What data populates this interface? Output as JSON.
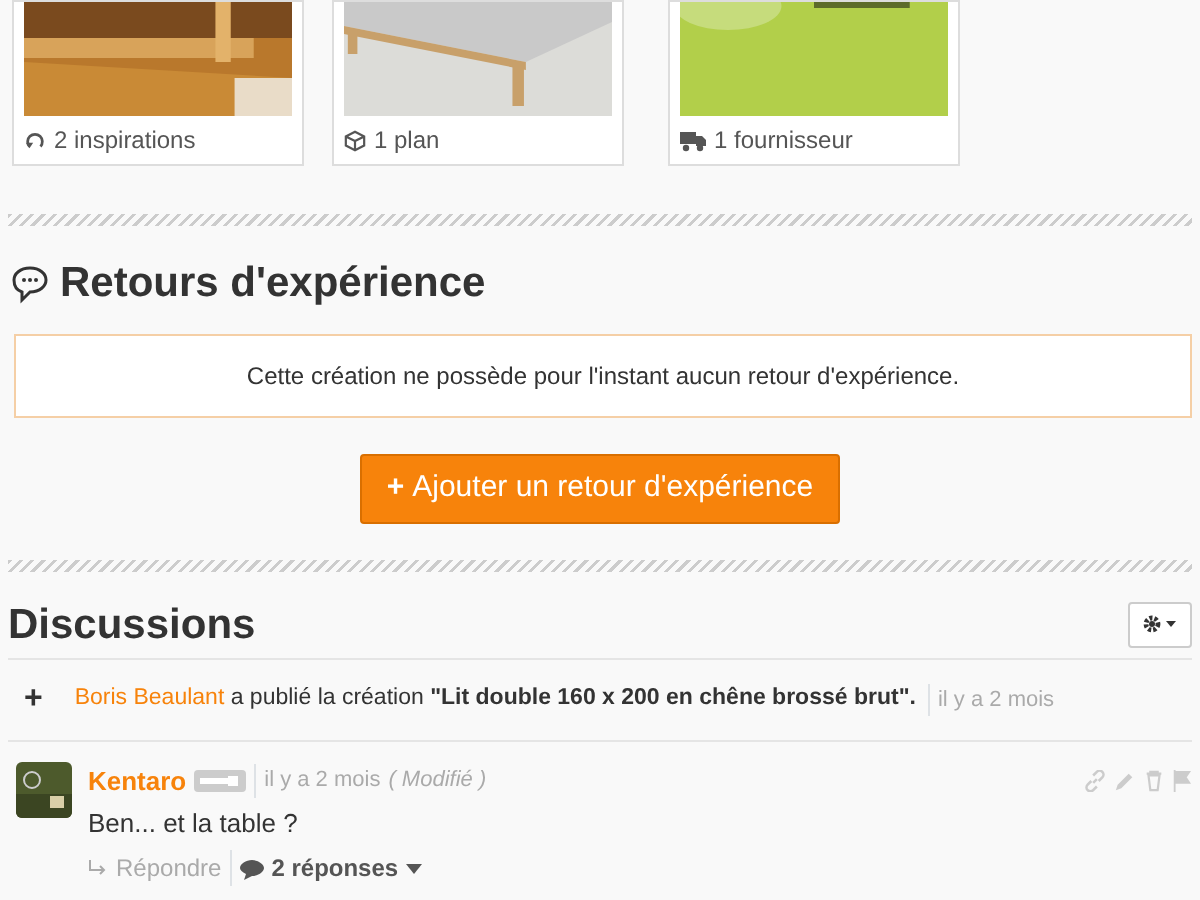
{
  "resources": [
    {
      "kind": "inspirations",
      "label": "2 inspirations"
    },
    {
      "kind": "plan",
      "label": "1 plan"
    },
    {
      "kind": "supplier",
      "label": "1 fournisseur"
    }
  ],
  "feedback": {
    "title": "Retours d'expérience",
    "notice": "Cette création ne possède pour l'instant aucun retour d'expérience.",
    "button": "Ajouter un retour d'expérience",
    "button_icon": "+"
  },
  "discussions": {
    "title": "Discussions",
    "activity": {
      "icon": "+",
      "author": "Boris Beaulant",
      "text": "a publié la création **\"Lit double 160 x 200 en chêne brossé brut\".**",
      "time": "il y a 2 mois"
    },
    "comments": [
      {
        "author": "Kentaro",
        "time": "il y a 2 mois",
        "edited": "( Modifié )",
        "text": "Ben... et la table ?",
        "reply": "Répondre",
        "replies": "2 réponses"
      }
    ]
  }
}
